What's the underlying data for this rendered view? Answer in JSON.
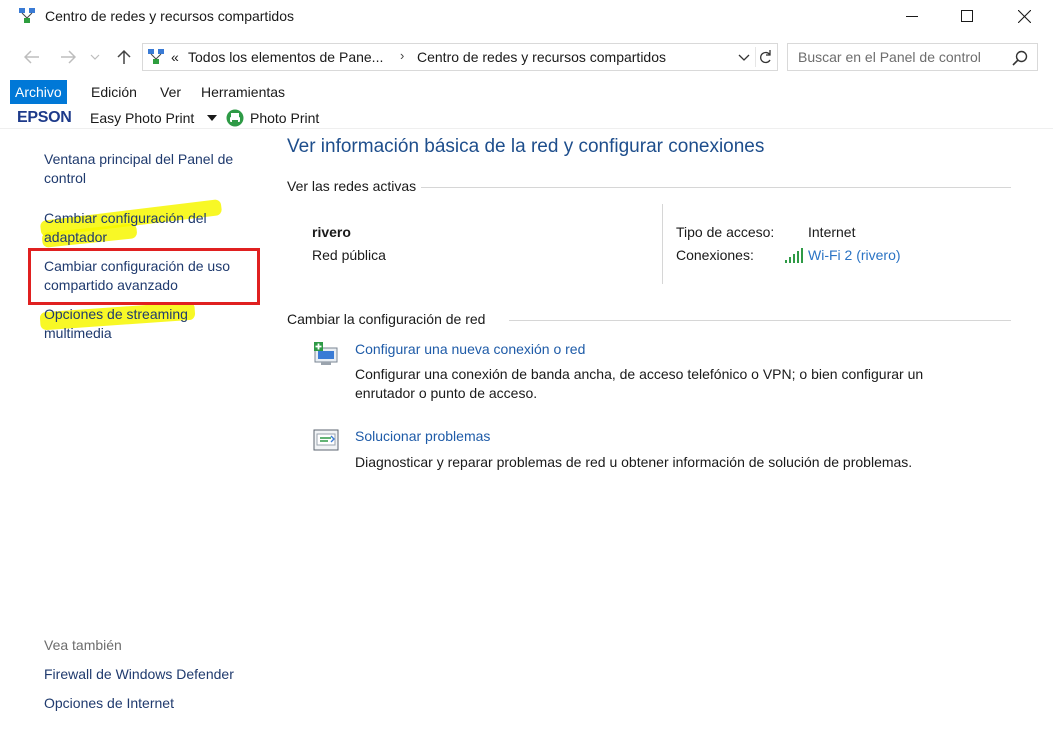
{
  "window": {
    "title": "Centro de redes y recursos compartidos",
    "icon": "network-center-icon",
    "controls": [
      "minimize-icon",
      "maximize-icon",
      "close-icon"
    ]
  },
  "addressbar": {
    "overflow": "«",
    "crumbs": [
      "Todos los elementos de Pane...",
      "Centro de redes y recursos compartidos"
    ],
    "separator": "›",
    "search_placeholder": "Buscar en el Panel de control"
  },
  "menubar": {
    "items": [
      "Archivo",
      "Edición",
      "Ver",
      "Herramientas"
    ],
    "active_index": 0
  },
  "epson_toolbar": {
    "brand": "EPSON",
    "easy_photo_print": "Easy Photo Print",
    "photo_print": "Photo Print"
  },
  "leftnav": {
    "links": [
      {
        "label_1": "Ventana principal del Panel de",
        "label_2": "control"
      },
      {
        "label_1": "Cambiar configuración del",
        "label_2": "adaptador"
      },
      {
        "label_1": "Cambiar configuración de uso",
        "label_2": "compartido avanzado"
      },
      {
        "label_1": "Opciones de streaming",
        "label_2": "multimedia"
      }
    ],
    "see_also_heading": "Vea también",
    "see_also": [
      "Firewall de Windows Defender",
      "Opciones de Internet"
    ]
  },
  "main": {
    "title": "Ver información básica de la red y configurar conexiones",
    "active_networks_heading": "Ver las redes activas",
    "network": {
      "name": "rivero",
      "type": "Red pública",
      "access_type_label": "Tipo de acceso:",
      "access_type_value": "Internet",
      "connections_label": "Conexiones:",
      "connection_link": "Wi-Fi 2 (rivero)"
    },
    "change_settings_heading": "Cambiar la configuración de red",
    "tasks": [
      {
        "title": "Configurar una nueva conexión o red",
        "desc_1": "Configurar una conexión de banda ancha, de acceso telefónico o VPN; o bien configurar un",
        "desc_2": "enrutador o punto de acceso.",
        "icon": "new-connection-icon"
      },
      {
        "title": "Solucionar problemas",
        "desc_1": "Diagnosticar y reparar problemas de red u obtener información de solución de problemas.",
        "icon": "troubleshoot-icon"
      }
    ]
  },
  "colors": {
    "link": "#1f3a6e",
    "accent": "#0078d7",
    "highlight": "#f7f700",
    "annotation_box": "#e02020"
  }
}
